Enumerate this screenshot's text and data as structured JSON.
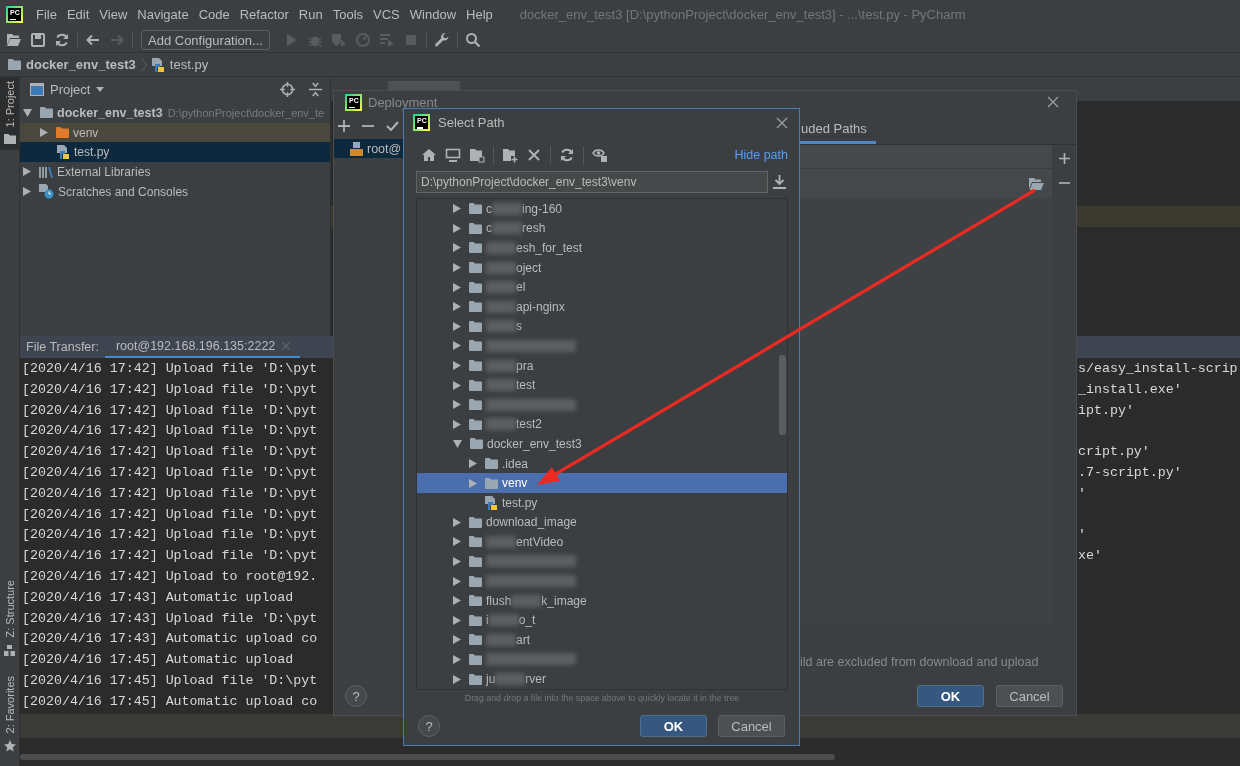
{
  "window": {
    "logo": "PC",
    "title": "docker_env_test3 [D:\\pythonProject\\docker_env_test3] - ...\\test.py - PyCharm"
  },
  "menu": [
    "File",
    "Edit",
    "View",
    "Navigate",
    "Code",
    "Refactor",
    "Run",
    "Tools",
    "VCS",
    "Window",
    "Help"
  ],
  "toolbar": {
    "items": [
      {
        "kind": "open",
        "disabled": false
      },
      {
        "kind": "save",
        "disabled": false
      },
      {
        "kind": "sync",
        "disabled": false
      },
      {
        "kind": "separator"
      },
      {
        "kind": "back",
        "disabled": false
      },
      {
        "kind": "forward",
        "disabled": true
      },
      {
        "kind": "separator"
      },
      {
        "kind": "configuration",
        "label": "Add Configuration..."
      },
      {
        "kind": "run",
        "disabled": true
      },
      {
        "kind": "debug",
        "disabled": true
      },
      {
        "kind": "coverage",
        "disabled": true
      },
      {
        "kind": "profile",
        "disabled": true
      },
      {
        "kind": "concurrency",
        "disabled": true
      },
      {
        "kind": "stop",
        "disabled": true
      },
      {
        "kind": "separator"
      },
      {
        "kind": "settings",
        "disabled": false
      },
      {
        "kind": "separator"
      },
      {
        "kind": "search",
        "disabled": false
      }
    ]
  },
  "navigation_bar": [
    {
      "kind": "folder",
      "label": "docker_env_test3"
    },
    {
      "kind": "python",
      "label": "test.py"
    }
  ],
  "tool_strip": [
    {
      "kind": "project",
      "label": "1: Project",
      "selected": true
    },
    {
      "kind": "structure",
      "label": "Z: Structure",
      "selected": false
    },
    {
      "kind": "favorites",
      "label": "2: Favorites",
      "selected": false
    }
  ],
  "project_panel": {
    "title": "Project",
    "tree": [
      {
        "kind": "project",
        "name": "docker_env_test3",
        "path": "D:\\pythonProject\\docker_env_te",
        "expanded": true,
        "selected": false,
        "children": [
          {
            "kind": "excluded",
            "name": "venv",
            "expanded": false,
            "selected": false
          },
          {
            "kind": "python",
            "name": "test.py",
            "selected": true
          }
        ]
      },
      {
        "kind": "libraries",
        "name": "External Libraries",
        "expanded": false,
        "selected": false
      },
      {
        "kind": "scratches",
        "name": "Scratches and Consoles",
        "expanded": false,
        "selected": false
      }
    ]
  },
  "file_transfer": {
    "label": "File Transfer:",
    "tabs": [
      {
        "label": "root@192.168.196.135:2222",
        "selected": true
      }
    ],
    "lines": [
      {
        "text": "[2020/4/16 17:42] Upload file 'D:\\pyt",
        "tail": "s/easy_install-scrip"
      },
      {
        "text": "[2020/4/16 17:42] Upload file 'D:\\pyt",
        "tail": "_install.exe'"
      },
      {
        "text": "[2020/4/16 17:42] Upload file 'D:\\pyt",
        "tail": "ipt.py'"
      },
      {
        "text": "[2020/4/16 17:42] Upload file 'D:\\pyt"
      },
      {
        "text": "[2020/4/16 17:42] Upload file 'D:\\pyt",
        "tail": "cript.py'"
      },
      {
        "text": "[2020/4/16 17:42] Upload file 'D:\\pyt",
        "tail": ".7-script.py'"
      },
      {
        "text": "[2020/4/16 17:42] Upload file 'D:\\pyt",
        "tail": "'"
      },
      {
        "text": "[2020/4/16 17:42] Upload file 'D:\\pyt"
      },
      {
        "text": "[2020/4/16 17:42] Upload file 'D:\\pyt",
        "tail": "'"
      },
      {
        "text": "[2020/4/16 17:42] Upload file 'D:\\pyt",
        "tail": "xe'"
      },
      {
        "text": "[2020/4/16 17:42] Upload to root@192."
      },
      {
        "text": "[2020/4/16 17:43] Automatic upload"
      },
      {
        "text": "[2020/4/16 17:43] Upload file 'D:\\pyt"
      },
      {
        "text": "[2020/4/16 17:43] Automatic upload co"
      },
      {
        "text": "[2020/4/16 17:45] Automatic upload"
      },
      {
        "text": "[2020/4/16 17:45] Upload file 'D:\\pyt"
      },
      {
        "text": "[2020/4/16 17:45] Automatic upload co"
      }
    ]
  },
  "deployment_dialog": {
    "logo": "PC",
    "title": "Deployment",
    "servers": [
      {
        "name": "root@",
        "selected": true
      }
    ],
    "tabs": [
      {
        "label": "uded Paths",
        "selected": true
      }
    ],
    "note": "ild are excluded from download and upload",
    "help": "?",
    "buttons": [
      {
        "kind": "default",
        "label": "OK"
      },
      {
        "kind": "normal",
        "label": "Cancel"
      }
    ]
  },
  "select_path_dialog": {
    "logo": "PC",
    "title": "Select Path",
    "hide_path": "Hide path",
    "path": "D:\\pythonProject\\docker_env_test3\\venv",
    "tree": [
      {
        "kind": "folder",
        "lead": "c",
        "name": "ing-160",
        "redacted": true,
        "expanded": false,
        "selected": false
      },
      {
        "kind": "folder",
        "lead": "c",
        "name": "resh",
        "redacted": true,
        "expanded": false,
        "selected": false
      },
      {
        "kind": "folder",
        "name": "esh_for_test",
        "redacted": true,
        "expanded": false,
        "selected": false
      },
      {
        "kind": "folder",
        "name": "oject",
        "redacted": true,
        "expanded": false,
        "selected": false
      },
      {
        "kind": "folder",
        "name": "el",
        "redacted": true,
        "expanded": false,
        "selected": false
      },
      {
        "kind": "folder",
        "name": "api-nginx",
        "redacted": true,
        "expanded": false,
        "selected": false
      },
      {
        "kind": "folder",
        "name": "s",
        "redacted": true,
        "expanded": false,
        "selected": false
      },
      {
        "kind": "folder",
        "redacted": true,
        "expanded": false,
        "selected": false
      },
      {
        "kind": "folder",
        "name": "pra",
        "redacted": true,
        "expanded": false,
        "selected": false
      },
      {
        "kind": "folder",
        "name": "test",
        "redacted": true,
        "expanded": false,
        "selected": false
      },
      {
        "kind": "folder",
        "redacted": true,
        "expanded": false,
        "selected": false
      },
      {
        "kind": "folder",
        "name": "test2",
        "redacted": true,
        "expanded": false,
        "selected": false
      },
      {
        "kind": "folder",
        "name": "docker_env_test3",
        "redacted": false,
        "expanded": true,
        "selected": false,
        "children": [
          {
            "kind": "folder",
            "name": ".idea",
            "redacted": false,
            "expanded": false,
            "selected": false
          },
          {
            "kind": "folder",
            "name": "venv",
            "redacted": false,
            "expanded": false,
            "selected": true
          },
          {
            "kind": "file",
            "name": "test.py",
            "redacted": false,
            "selected": false
          }
        ]
      },
      {
        "kind": "folder",
        "name": "download_image",
        "redacted": false,
        "expanded": false,
        "selected": false
      },
      {
        "kind": "folder",
        "name": "entVideo",
        "redacted": true,
        "expanded": false,
        "selected": false
      },
      {
        "kind": "folder",
        "redacted": true,
        "expanded": false,
        "selected": false
      },
      {
        "kind": "folder",
        "redacted": true,
        "expanded": false,
        "selected": false
      },
      {
        "kind": "folder",
        "lead": "flush",
        "name": "k_image",
        "redacted": true,
        "expanded": false,
        "selected": false
      },
      {
        "kind": "folder",
        "lead": "i",
        "name": "o_t",
        "redacted": true,
        "expanded": false,
        "selected": false
      },
      {
        "kind": "folder",
        "name": "art",
        "redacted": true,
        "expanded": false,
        "selected": false
      },
      {
        "kind": "folder",
        "redacted": true,
        "expanded": false,
        "selected": false
      },
      {
        "kind": "folder",
        "lead": "ju",
        "name": "rver",
        "redacted": true,
        "expanded": false,
        "selected": false
      }
    ],
    "hint": "Drag and drop a file into the space above to quickly locate it in the tree",
    "help": "?",
    "buttons": [
      {
        "kind": "default",
        "label": "OK"
      },
      {
        "kind": "normal",
        "label": "Cancel"
      }
    ]
  }
}
